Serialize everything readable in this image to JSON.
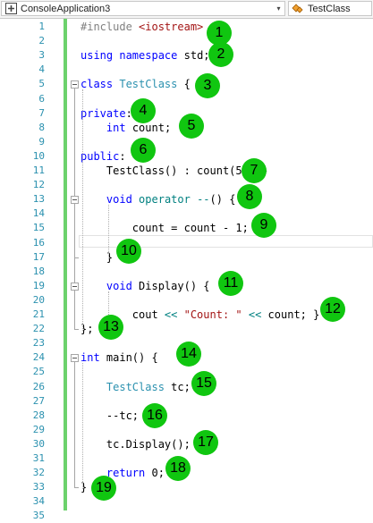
{
  "navbar": {
    "project": "ConsoleApplication3",
    "scope": "TestClass",
    "dropdown_arrow": "▾"
  },
  "lines": [
    {
      "n": "1",
      "segs": [
        {
          "t": "#include ",
          "c": "pp"
        },
        {
          "t": "<iostream>",
          "c": "str"
        }
      ]
    },
    {
      "n": "2",
      "segs": []
    },
    {
      "n": "3",
      "segs": [
        {
          "t": "using",
          "c": "kw"
        },
        {
          "t": " "
        },
        {
          "t": "namespace",
          "c": "kw"
        },
        {
          "t": " std;"
        }
      ]
    },
    {
      "n": "4",
      "segs": []
    },
    {
      "n": "5",
      "segs": [
        {
          "t": "class",
          "c": "kw"
        },
        {
          "t": " "
        },
        {
          "t": "TestClass",
          "c": "ty"
        },
        {
          "t": " {"
        }
      ]
    },
    {
      "n": "6",
      "segs": []
    },
    {
      "n": "7",
      "segs": [
        {
          "t": "private",
          "c": "kw"
        },
        {
          "t": ":"
        }
      ]
    },
    {
      "n": "8",
      "segs": [
        {
          "t": "    "
        },
        {
          "t": "int",
          "c": "kw"
        },
        {
          "t": " count;"
        }
      ]
    },
    {
      "n": "9",
      "segs": []
    },
    {
      "n": "10",
      "segs": [
        {
          "t": "public",
          "c": "kw"
        },
        {
          "t": ":"
        }
      ]
    },
    {
      "n": "11",
      "segs": [
        {
          "t": "    TestClass() : count(5) {}"
        }
      ]
    },
    {
      "n": "12",
      "segs": []
    },
    {
      "n": "13",
      "segs": [
        {
          "t": "    "
        },
        {
          "t": "void",
          "c": "kw"
        },
        {
          "t": " "
        },
        {
          "t": "operator --",
          "c": "op"
        },
        {
          "t": "() {"
        }
      ]
    },
    {
      "n": "14",
      "segs": []
    },
    {
      "n": "15",
      "segs": [
        {
          "t": "        count = count - 1;"
        }
      ]
    },
    {
      "n": "16",
      "segs": []
    },
    {
      "n": "17",
      "segs": [
        {
          "t": "    }"
        }
      ]
    },
    {
      "n": "18",
      "segs": []
    },
    {
      "n": "19",
      "segs": [
        {
          "t": "    "
        },
        {
          "t": "void",
          "c": "kw"
        },
        {
          "t": " Display() {"
        }
      ]
    },
    {
      "n": "20",
      "segs": []
    },
    {
      "n": "21",
      "segs": [
        {
          "t": "        cout "
        },
        {
          "t": "<<",
          "c": "op"
        },
        {
          "t": " "
        },
        {
          "t": "\"Count: \"",
          "c": "str"
        },
        {
          "t": " "
        },
        {
          "t": "<<",
          "c": "op"
        },
        {
          "t": " count; }"
        }
      ]
    },
    {
      "n": "22",
      "segs": [
        {
          "t": "};"
        }
      ]
    },
    {
      "n": "23",
      "segs": []
    },
    {
      "n": "24",
      "segs": [
        {
          "t": "int",
          "c": "kw"
        },
        {
          "t": " main() {"
        }
      ]
    },
    {
      "n": "25",
      "segs": []
    },
    {
      "n": "26",
      "segs": [
        {
          "t": "    "
        },
        {
          "t": "TestClass",
          "c": "ty"
        },
        {
          "t": " tc;"
        }
      ]
    },
    {
      "n": "27",
      "segs": []
    },
    {
      "n": "28",
      "segs": [
        {
          "t": "    --tc;"
        }
      ]
    },
    {
      "n": "29",
      "segs": []
    },
    {
      "n": "30",
      "segs": [
        {
          "t": "    tc.Display();"
        }
      ]
    },
    {
      "n": "31",
      "segs": []
    },
    {
      "n": "32",
      "segs": [
        {
          "t": "    "
        },
        {
          "t": "return",
          "c": "kw"
        },
        {
          "t": " 0;"
        }
      ]
    },
    {
      "n": "33",
      "segs": [
        {
          "t": "}"
        }
      ]
    },
    {
      "n": "34",
      "segs": []
    },
    {
      "n": "35",
      "segs": []
    }
  ],
  "badges": [
    "1",
    "2",
    "3",
    "4",
    "5",
    "6",
    "7",
    "8",
    "9",
    "10",
    "11",
    "12",
    "13",
    "14",
    "15",
    "16",
    "17",
    "18",
    "19"
  ],
  "colors": {
    "keyword": "#0000ff",
    "type": "#2b91af",
    "string": "#a31515",
    "preprocessor": "#808080",
    "operator": "#008080",
    "line_number": "#2b91af",
    "change_bar": "#6cd26c",
    "badge": "#10c610"
  }
}
